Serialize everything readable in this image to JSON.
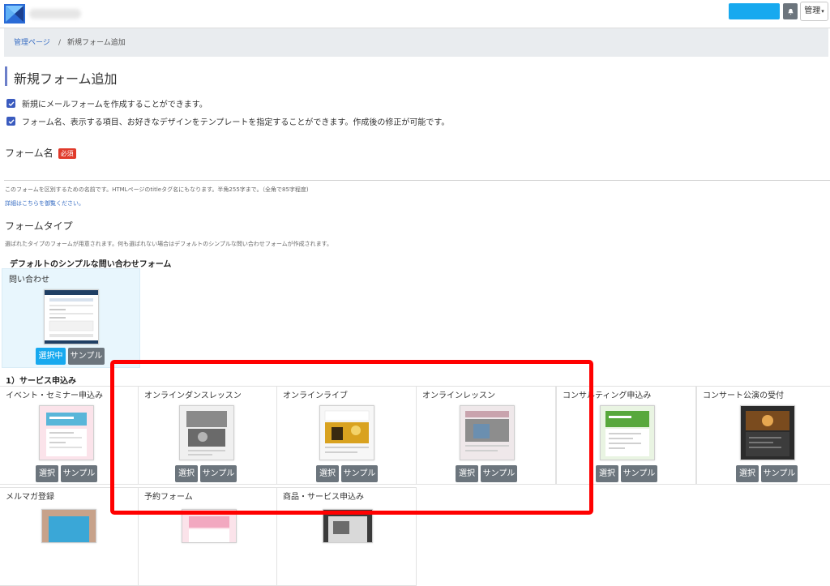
{
  "navbar": {
    "admin_label": "管理"
  },
  "breadcrumb": {
    "home": "管理ページ",
    "separator": "/",
    "current": "新規フォーム追加"
  },
  "page": {
    "title": "新規フォーム追加",
    "checks": [
      "新規にメールフォームを作成することができます。",
      "フォーム名、表示する項目、お好きなデザインをテンプレートを指定することができます。作成後の修正が可能です。"
    ]
  },
  "form_name": {
    "label": "フォーム名",
    "required_badge": "必須",
    "value": "",
    "help": "このフォームを区別するための名前です。HTMLページのtitleタグ名にもなります。半角255字まで。（全角で85字程度)",
    "detail_link": "詳細はこちらを御覧ください。"
  },
  "form_type": {
    "label": "フォームタイプ",
    "help": "選ばれたタイプのフォームが用意されます。何も選ばれない場合はデフォルトのシンプルな問い合わせフォームが作成されます。",
    "default_heading": "デフォルトのシンプルな問い合わせフォーム",
    "default_card": {
      "title": "問い合わせ",
      "selected_label": "選択中",
      "sample_label": "サンプル"
    },
    "category_heading": "1）サービス申込み",
    "select_label": "選択",
    "sample_label": "サンプル",
    "templates_row1": [
      "イベント・セミナー申込み",
      "オンラインダンスレッスン",
      "オンラインライブ",
      "オンラインレッスン",
      "コンサルティング申込み",
      "コンサート公演の受付"
    ],
    "templates_row2": [
      "メルマガ登録",
      "予約フォーム",
      "商品・サービス申込み"
    ]
  },
  "colors": {
    "accent_blue": "#17a9ef",
    "button_gray": "#6c757d",
    "highlight_red": "#ff0000",
    "required_red": "#e03a2b"
  }
}
